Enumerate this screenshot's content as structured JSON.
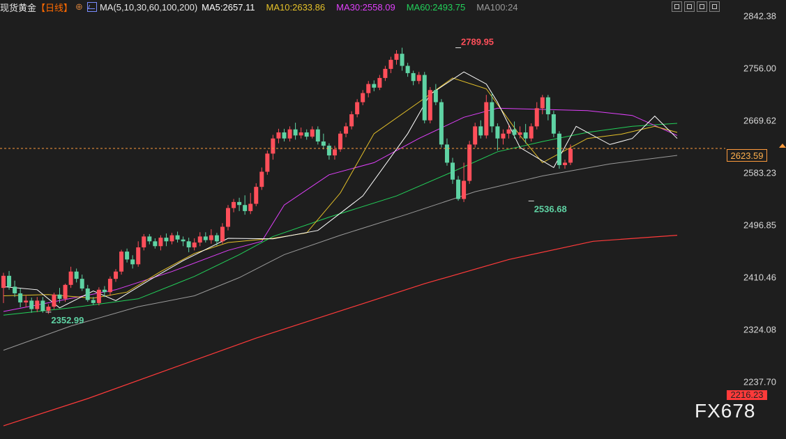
{
  "header": {
    "symbol": "现货黄金",
    "period": "【日线】",
    "add_symbol": "⊕",
    "ma_params": "MA(5,10,30,60,100,200)",
    "ma_items": [
      {
        "text": "MA5:2657.11",
        "color": "#ffffff"
      },
      {
        "text": "MA10:2633.86",
        "color": "#e6c229"
      },
      {
        "text": "MA30:2558.09",
        "color": "#e040fb"
      },
      {
        "text": "MA60:2493.75",
        "color": "#22d15a"
      },
      {
        "text": "MA100:24",
        "color": "#9a9a9a"
      }
    ]
  },
  "toolbar": {
    "icons": [
      "zoom-icon",
      "window-icon",
      "layout-icon",
      "fullscreen-icon"
    ]
  },
  "watermark": "FX678",
  "last_price_label": "2623.59",
  "bottom_tag": "2216.23",
  "chart_data": {
    "type": "candlestick",
    "title": "现货黄金",
    "period": "日线",
    "y_ticks": [
      "2842.38",
      "2756.00",
      "2669.62",
      "2583.23",
      "2496.85",
      "2410.46",
      "2324.08",
      "2237.70"
    ],
    "ylim": [
      2200,
      2850
    ],
    "last_price": 2623.59,
    "annotations": [
      {
        "text": "2789.95",
        "value": 2789.95,
        "index": 81,
        "color": "#ff4f5a"
      },
      {
        "text": "2536.68",
        "value": 2536.68,
        "index": 94,
        "color": "#5fd3a4"
      },
      {
        "text": "2352.99",
        "value": 2352.99,
        "index": 8,
        "color": "#5fd3a4"
      }
    ],
    "colors": {
      "up": "#ff4f5a",
      "down": "#5fd3a4",
      "ma5": "#ffffff",
      "ma10": "#e6c229",
      "ma30": "#e040fb",
      "ma60": "#22d15a",
      "ma100": "#9a9a9a",
      "ma200": "#ff3a3a",
      "last": "#ff9b3c"
    },
    "moving_averages": {
      "ma5": [
        [
          0,
          2395
        ],
        [
          6,
          2390
        ],
        [
          10,
          2360
        ],
        [
          16,
          2388
        ],
        [
          20,
          2372
        ],
        [
          26,
          2406
        ],
        [
          32,
          2438
        ],
        [
          40,
          2475
        ],
        [
          48,
          2474
        ],
        [
          56,
          2488
        ],
        [
          64,
          2545
        ],
        [
          72,
          2648
        ],
        [
          76,
          2713
        ],
        [
          82,
          2750
        ],
        [
          86,
          2730
        ],
        [
          88,
          2700
        ],
        [
          92,
          2625
        ],
        [
          98,
          2592
        ],
        [
          102,
          2660
        ],
        [
          108,
          2630
        ],
        [
          112,
          2640
        ],
        [
          116,
          2677
        ],
        [
          120,
          2640
        ]
      ],
      "ma10": [
        [
          0,
          2380
        ],
        [
          8,
          2382
        ],
        [
          16,
          2376
        ],
        [
          22,
          2386
        ],
        [
          28,
          2420
        ],
        [
          34,
          2450
        ],
        [
          40,
          2468
        ],
        [
          48,
          2475
        ],
        [
          54,
          2484
        ],
        [
          60,
          2550
        ],
        [
          66,
          2648
        ],
        [
          74,
          2700
        ],
        [
          80,
          2740
        ],
        [
          86,
          2722
        ],
        [
          92,
          2645
        ],
        [
          96,
          2600
        ],
        [
          104,
          2640
        ],
        [
          110,
          2647
        ],
        [
          116,
          2660
        ],
        [
          120,
          2650
        ]
      ],
      "ma30": [
        [
          0,
          2354
        ],
        [
          10,
          2372
        ],
        [
          20,
          2390
        ],
        [
          30,
          2420
        ],
        [
          40,
          2455
        ],
        [
          46,
          2470
        ],
        [
          50,
          2530
        ],
        [
          58,
          2580
        ],
        [
          66,
          2600
        ],
        [
          74,
          2640
        ],
        [
          82,
          2675
        ],
        [
          88,
          2690
        ],
        [
          96,
          2688
        ],
        [
          104,
          2686
        ],
        [
          112,
          2678
        ],
        [
          120,
          2645
        ]
      ],
      "ma60": [
        [
          0,
          2348
        ],
        [
          12,
          2360
        ],
        [
          24,
          2375
        ],
        [
          34,
          2412
        ],
        [
          42,
          2448
        ],
        [
          48,
          2478
        ],
        [
          58,
          2510
        ],
        [
          70,
          2545
        ],
        [
          80,
          2585
        ],
        [
          88,
          2618
        ],
        [
          96,
          2635
        ],
        [
          104,
          2650
        ],
        [
          112,
          2660
        ],
        [
          120,
          2665
        ]
      ],
      "ma100": [
        [
          0,
          2290
        ],
        [
          12,
          2330
        ],
        [
          24,
          2362
        ],
        [
          34,
          2380
        ],
        [
          42,
          2410
        ],
        [
          50,
          2448
        ],
        [
          60,
          2480
        ],
        [
          72,
          2515
        ],
        [
          84,
          2552
        ],
        [
          96,
          2578
        ],
        [
          108,
          2598
        ],
        [
          120,
          2612
        ]
      ],
      "ma200": [
        [
          0,
          2165
        ],
        [
          15,
          2210
        ],
        [
          30,
          2260
        ],
        [
          45,
          2310
        ],
        [
          60,
          2355
        ],
        [
          75,
          2400
        ],
        [
          90,
          2440
        ],
        [
          105,
          2470
        ],
        [
          120,
          2480
        ]
      ]
    },
    "candles": [
      [
        2393,
        2413,
        2368,
        2418
      ],
      [
        2413,
        2395,
        2390,
        2421
      ],
      [
        2395,
        2384,
        2378,
        2405
      ],
      [
        2384,
        2369,
        2361,
        2392
      ],
      [
        2369,
        2372,
        2361,
        2380
      ],
      [
        2372,
        2358,
        2352,
        2377
      ],
      [
        2358,
        2372,
        2353,
        2378
      ],
      [
        2372,
        2355,
        2352,
        2378
      ],
      [
        2355,
        2362,
        2350,
        2366
      ],
      [
        2362,
        2382,
        2358,
        2385
      ],
      [
        2382,
        2375,
        2368,
        2393
      ],
      [
        2375,
        2398,
        2370,
        2400
      ],
      [
        2398,
        2420,
        2393,
        2428
      ],
      [
        2420,
        2408,
        2402,
        2425
      ],
      [
        2408,
        2392,
        2388,
        2415
      ],
      [
        2392,
        2373,
        2370,
        2398
      ],
      [
        2373,
        2368,
        2365,
        2378
      ],
      [
        2368,
        2390,
        2364,
        2394
      ],
      [
        2390,
        2386,
        2378,
        2396
      ],
      [
        2386,
        2408,
        2380,
        2412
      ],
      [
        2408,
        2420,
        2403,
        2424
      ],
      [
        2420,
        2453,
        2415,
        2456
      ],
      [
        2453,
        2440,
        2435,
        2458
      ],
      [
        2440,
        2432,
        2425,
        2447
      ],
      [
        2432,
        2460,
        2428,
        2470
      ],
      [
        2460,
        2478,
        2455,
        2482
      ],
      [
        2478,
        2470,
        2465,
        2482
      ],
      [
        2470,
        2462,
        2458,
        2475
      ],
      [
        2462,
        2476,
        2455,
        2480
      ],
      [
        2476,
        2470,
        2462,
        2483
      ],
      [
        2470,
        2480,
        2465,
        2484
      ],
      [
        2480,
        2473,
        2468,
        2486
      ],
      [
        2473,
        2470,
        2462,
        2478
      ],
      [
        2470,
        2460,
        2452,
        2476
      ],
      [
        2460,
        2468,
        2455,
        2475
      ],
      [
        2468,
        2478,
        2462,
        2485
      ],
      [
        2478,
        2472,
        2468,
        2485
      ],
      [
        2472,
        2480,
        2466,
        2490
      ],
      [
        2480,
        2470,
        2463,
        2484
      ],
      [
        2470,
        2494,
        2466,
        2500
      ],
      [
        2494,
        2525,
        2488,
        2530
      ],
      [
        2525,
        2535,
        2518,
        2540
      ],
      [
        2535,
        2530,
        2520,
        2542
      ],
      [
        2530,
        2520,
        2514,
        2546
      ],
      [
        2520,
        2532,
        2515,
        2550
      ],
      [
        2532,
        2560,
        2528,
        2566
      ],
      [
        2560,
        2585,
        2555,
        2592
      ],
      [
        2585,
        2615,
        2580,
        2620
      ],
      [
        2615,
        2640,
        2605,
        2646
      ],
      [
        2640,
        2650,
        2632,
        2656
      ],
      [
        2650,
        2640,
        2635,
        2656
      ],
      [
        2640,
        2655,
        2635,
        2660
      ],
      [
        2655,
        2645,
        2638,
        2666
      ],
      [
        2645,
        2650,
        2640,
        2658
      ],
      [
        2650,
        2643,
        2638,
        2655
      ],
      [
        2643,
        2655,
        2640,
        2660
      ],
      [
        2655,
        2635,
        2630,
        2660
      ],
      [
        2635,
        2628,
        2622,
        2648
      ],
      [
        2628,
        2612,
        2605,
        2632
      ],
      [
        2612,
        2622,
        2605,
        2628
      ],
      [
        2622,
        2648,
        2618,
        2652
      ],
      [
        2648,
        2660,
        2642,
        2666
      ],
      [
        2660,
        2680,
        2655,
        2685
      ],
      [
        2680,
        2700,
        2675,
        2705
      ],
      [
        2700,
        2715,
        2695,
        2720
      ],
      [
        2715,
        2730,
        2708,
        2735
      ],
      [
        2730,
        2724,
        2718,
        2736
      ],
      [
        2724,
        2740,
        2720,
        2745
      ],
      [
        2740,
        2755,
        2735,
        2760
      ],
      [
        2755,
        2770,
        2748,
        2775
      ],
      [
        2770,
        2780,
        2762,
        2786
      ],
      [
        2780,
        2760,
        2752,
        2790
      ],
      [
        2760,
        2748,
        2742,
        2765
      ],
      [
        2748,
        2735,
        2728,
        2752
      ],
      [
        2735,
        2745,
        2730,
        2750
      ],
      [
        2745,
        2670,
        2665,
        2750
      ],
      [
        2670,
        2720,
        2665,
        2725
      ],
      [
        2720,
        2700,
        2695,
        2730
      ],
      [
        2700,
        2630,
        2625,
        2705
      ],
      [
        2630,
        2600,
        2595,
        2640
      ],
      [
        2600,
        2572,
        2565,
        2608
      ],
      [
        2572,
        2540,
        2537,
        2578
      ],
      [
        2540,
        2570,
        2535,
        2600
      ],
      [
        2570,
        2630,
        2565,
        2636
      ],
      [
        2630,
        2660,
        2625,
        2666
      ],
      [
        2660,
        2645,
        2640,
        2670
      ],
      [
        2645,
        2700,
        2640,
        2712
      ],
      [
        2700,
        2660,
        2650,
        2716
      ],
      [
        2660,
        2640,
        2620,
        2665
      ],
      [
        2640,
        2648,
        2630,
        2655
      ],
      [
        2648,
        2655,
        2640,
        2662
      ],
      [
        2655,
        2646,
        2640,
        2668
      ],
      [
        2646,
        2650,
        2640,
        2660
      ],
      [
        2650,
        2640,
        2632,
        2664
      ],
      [
        2640,
        2660,
        2635,
        2665
      ],
      [
        2660,
        2690,
        2655,
        2700
      ],
      [
        2690,
        2708,
        2680,
        2712
      ],
      [
        2708,
        2680,
        2670,
        2712
      ],
      [
        2680,
        2648,
        2642,
        2686
      ],
      [
        2648,
        2596,
        2590,
        2652
      ],
      [
        2596,
        2600,
        2590,
        2605
      ],
      [
        2600,
        2623,
        2596,
        2630
      ]
    ]
  }
}
